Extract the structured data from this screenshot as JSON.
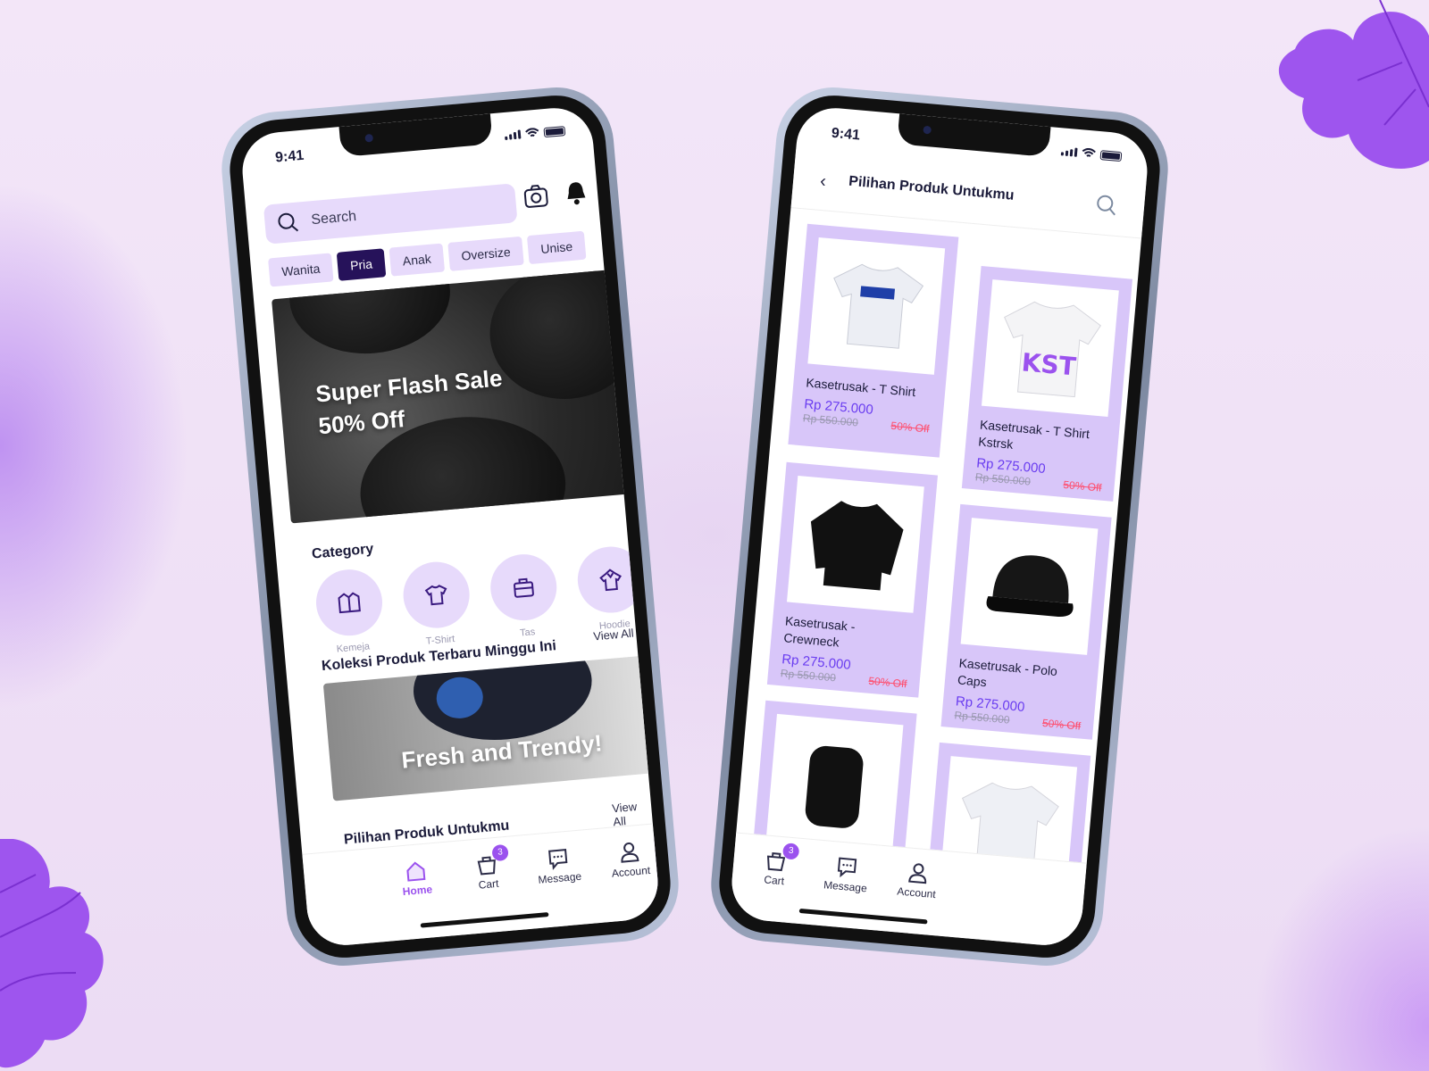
{
  "status": {
    "time": "9:41"
  },
  "home": {
    "search_placeholder": "Search",
    "tabs": [
      {
        "label": "Wanita"
      },
      {
        "label": "Pria"
      },
      {
        "label": "Anak"
      },
      {
        "label": "Oversize"
      },
      {
        "label": "Unise"
      }
    ],
    "banner": {
      "line1": "Super Flash Sale",
      "line2": "50% Off"
    },
    "category": {
      "title": "Category",
      "items": [
        {
          "label": "Kemeja",
          "icon": "shirt-collar-icon"
        },
        {
          "label": "T-Shirt",
          "icon": "tshirt-icon"
        },
        {
          "label": "Tas",
          "icon": "bag-icon"
        },
        {
          "label": "Hoodie",
          "icon": "hoodie-icon"
        }
      ]
    },
    "collection": {
      "title": "Koleksi Produk Terbaru Minggu Ini",
      "view_all": "View All",
      "banner_text": "Fresh and Trendy!"
    },
    "picks": {
      "title": "Pilihan Produk Untukmu",
      "view_all": "View All"
    }
  },
  "nav": {
    "home": "Home",
    "cart": "Cart",
    "cart_badge": "3",
    "message": "Message",
    "account": "Account",
    "accent": "#9b52ee"
  },
  "list": {
    "title": "Pilihan Produk Untukmu",
    "products": [
      {
        "name": "Kasetrusak - T Shirt",
        "price": "Rp 275.000",
        "old": "Rp 550.000",
        "off": "50% Off"
      },
      {
        "name": "Kasetrusak - T Shirt Kstrsk",
        "price": "Rp 275.000",
        "old": "Rp 550.000",
        "off": "50% Off",
        "print": "KST"
      },
      {
        "name": "Kasetrusak - Crewneck",
        "price": "Rp 275.000",
        "old": "Rp 550.000",
        "off": "50% Off"
      },
      {
        "name": "Kasetrusak - Polo Caps",
        "price": "Rp 275.000",
        "old": "Rp 550.000",
        "off": "50% Off"
      }
    ]
  }
}
